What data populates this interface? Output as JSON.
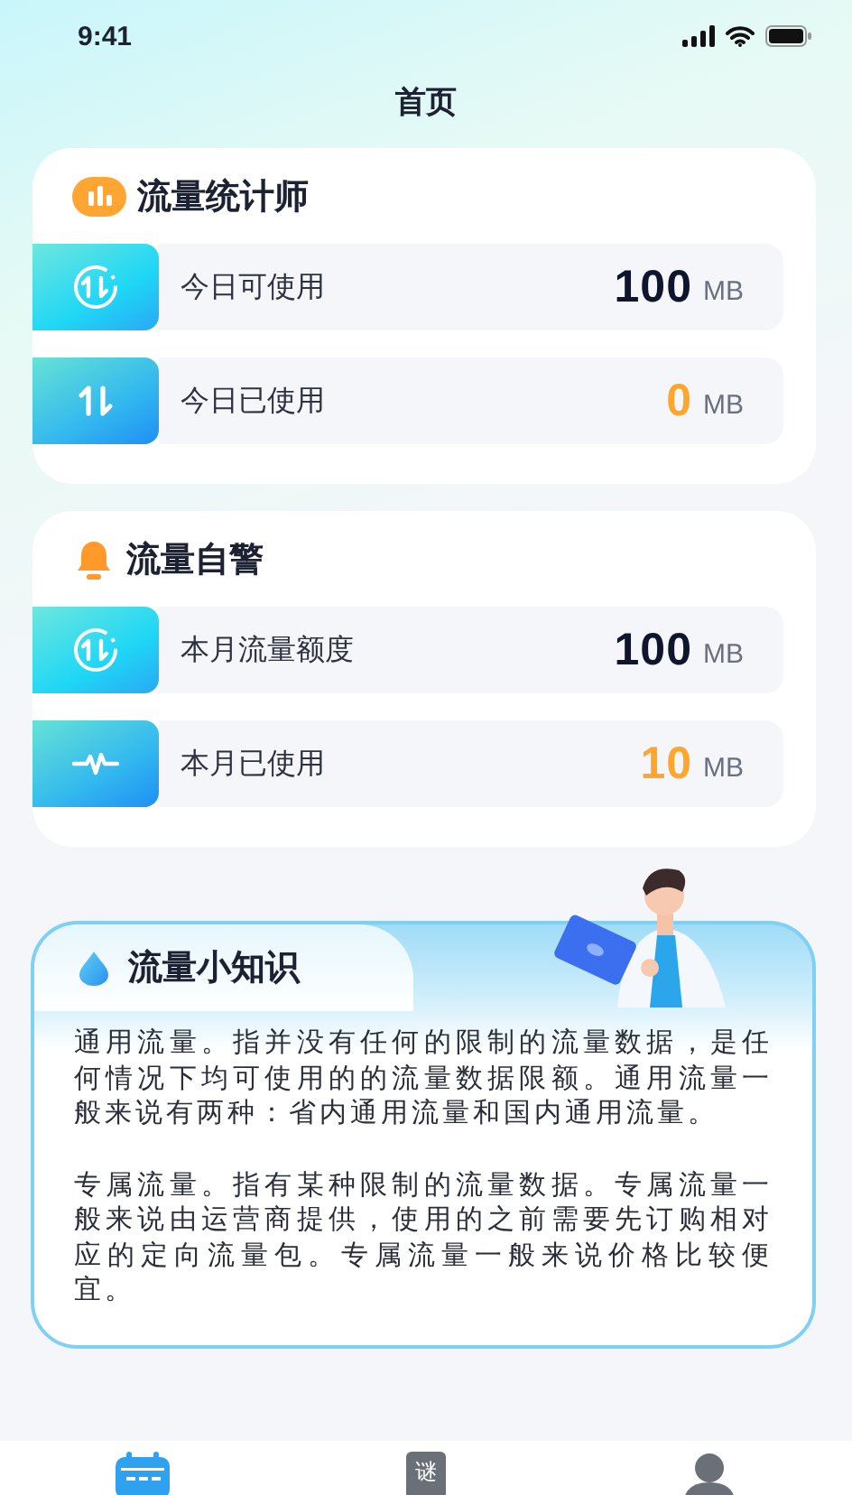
{
  "status_bar": {
    "time": "9:41"
  },
  "title": "首页",
  "sections": [
    {
      "title": "流量统计师",
      "rows": [
        {
          "label": "今日可使用",
          "value": "100",
          "unit": "MB",
          "color": "#10152e"
        },
        {
          "label": "今日已使用",
          "value": "0",
          "unit": "MB",
          "color": "#ffa62e"
        }
      ]
    },
    {
      "title": "流量自警",
      "rows": [
        {
          "label": "本月流量额度",
          "value": "100",
          "unit": "MB",
          "color": "#10152e"
        },
        {
          "label": "本月已使用",
          "value": "10",
          "unit": "MB",
          "color": "#ffa62e"
        }
      ]
    }
  ],
  "knowledge": {
    "title": "流量小知识",
    "paragraphs": [
      "通用流量。指并没有任何的限制的流量数据，是任何情况下均可使用的的流量数据限额。通用流量一般来说有两种：省内通用流量和国内通用流量。",
      "专属流量。指有某种限制的流量数据。专属流量一般来说由运营商提供，使用的之前需要先订购相对应的定向流量包。专属流量一般来说价格比较便宜。"
    ]
  },
  "tab_bar": [
    {
      "selected": true
    },
    {
      "glyph": "谜",
      "selected": false
    },
    {
      "selected": false
    }
  ]
}
